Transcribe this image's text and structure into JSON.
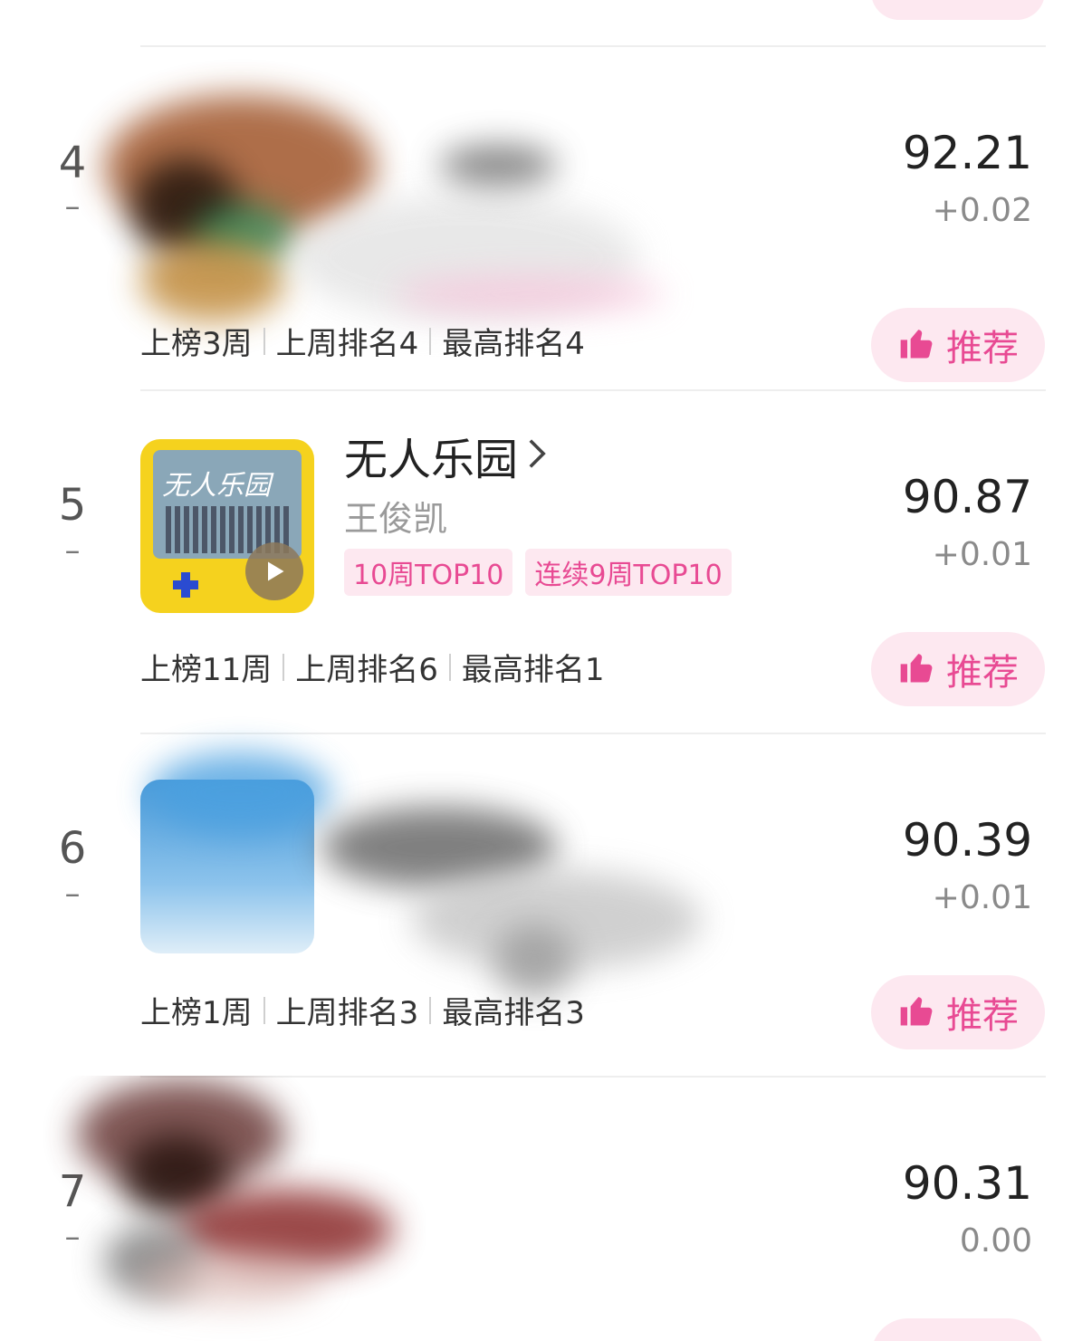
{
  "recommend_label": "推荐",
  "entries": [
    {
      "rank": "4",
      "change": "–",
      "score": "92.21",
      "delta": "+0.02",
      "stats": [
        "上榜3周",
        "上周排名4",
        "最高排名4"
      ]
    },
    {
      "rank": "5",
      "change": "–",
      "title": "无人乐园",
      "artist": "王俊凯",
      "tags": [
        "10周TOP10",
        "连续9周TOP10"
      ],
      "cover_text": "无人乐园",
      "score": "90.87",
      "delta": "+0.01",
      "stats": [
        "上榜11周",
        "上周排名6",
        "最高排名1"
      ]
    },
    {
      "rank": "6",
      "change": "–",
      "score": "90.39",
      "delta": "+0.01",
      "stats": [
        "上榜1周",
        "上周排名3",
        "最高排名3"
      ]
    },
    {
      "rank": "7",
      "change": "–",
      "score": "90.31",
      "delta": "0.00"
    }
  ],
  "colors": {
    "accent": "#e84a93",
    "pill_bg": "#fde8f0",
    "cover_yellow": "#f5d21e"
  },
  "icons": {
    "recommend": "thumbs-up-icon",
    "chevron": "chevron-right-icon",
    "play": "play-icon"
  }
}
